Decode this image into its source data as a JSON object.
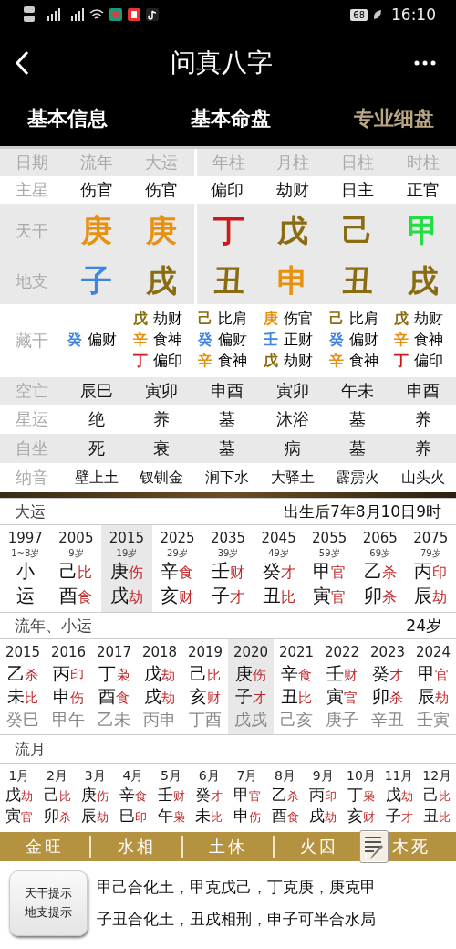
{
  "status_bar": {
    "battery": "68",
    "time": "16:10"
  },
  "header": {
    "title": "问真八字"
  },
  "tabs": [
    {
      "label": "基本信息",
      "selected": false
    },
    {
      "label": "基本命盘",
      "selected": false
    },
    {
      "label": "专业细盘",
      "selected": true
    }
  ],
  "pillars": {
    "columns": [
      "日期",
      "流年",
      "大运",
      "年柱",
      "月柱",
      "日柱",
      "时柱"
    ],
    "main_star": {
      "label": "主星",
      "values": [
        "伤官",
        "伤官",
        "偏印",
        "劫财",
        "日主",
        "正官"
      ]
    },
    "stems": {
      "label": "天干",
      "values": [
        {
          "char": "庚",
          "color": "#e8900f"
        },
        {
          "char": "庚",
          "color": "#e8900f"
        },
        {
          "char": "丁",
          "color": "#cc1a1a"
        },
        {
          "char": "戊",
          "color": "#8a6d12"
        },
        {
          "char": "己",
          "color": "#8a6d12"
        },
        {
          "char": "甲",
          "color": "#22dd44"
        }
      ]
    },
    "branches": {
      "label": "地支",
      "values": [
        {
          "char": "子",
          "color": "#3d85e0"
        },
        {
          "char": "戌",
          "color": "#8a6d12"
        },
        {
          "char": "丑",
          "color": "#8a6d12"
        },
        {
          "char": "申",
          "color": "#e8900f"
        },
        {
          "char": "丑",
          "color": "#8a6d12"
        },
        {
          "char": "戌",
          "color": "#8a6d12"
        }
      ]
    },
    "hidden": {
      "label": "藏干",
      "cells": [
        [
          {
            "char": "癸",
            "color": "#3d85e0",
            "god": "偏财"
          }
        ],
        [
          {
            "char": "戊",
            "color": "#8a6d12",
            "god": "劫财"
          },
          {
            "char": "辛",
            "color": "#e8900f",
            "god": "食神"
          },
          {
            "char": "丁",
            "color": "#cc1a1a",
            "god": "偏印"
          }
        ],
        [
          {
            "char": "己",
            "color": "#8a6d12",
            "god": "比肩"
          },
          {
            "char": "癸",
            "color": "#3d85e0",
            "god": "偏财"
          },
          {
            "char": "辛",
            "color": "#e8900f",
            "god": "食神"
          }
        ],
        [
          {
            "char": "庚",
            "color": "#e8900f",
            "god": "伤官"
          },
          {
            "char": "壬",
            "color": "#3d85e0",
            "god": "正财"
          },
          {
            "char": "戊",
            "color": "#8a6d12",
            "god": "劫财"
          }
        ],
        [
          {
            "char": "己",
            "color": "#8a6d12",
            "god": "比肩"
          },
          {
            "char": "癸",
            "color": "#3d85e0",
            "god": "偏财"
          },
          {
            "char": "辛",
            "color": "#e8900f",
            "god": "食神"
          }
        ],
        [
          {
            "char": "戊",
            "color": "#8a6d12",
            "god": "劫财"
          },
          {
            "char": "辛",
            "color": "#e8900f",
            "god": "食神"
          },
          {
            "char": "丁",
            "color": "#cc1a1a",
            "god": "偏印"
          }
        ]
      ]
    },
    "info_rows": [
      {
        "label": "空亡",
        "values": [
          "辰巳",
          "寅卯",
          "申酉",
          "寅卯",
          "午未",
          "申酉"
        ]
      },
      {
        "label": "星运",
        "values": [
          "绝",
          "养",
          "墓",
          "沐浴",
          "墓",
          "养"
        ]
      },
      {
        "label": "自坐",
        "values": [
          "死",
          "衰",
          "墓",
          "病",
          "墓",
          "养"
        ]
      },
      {
        "label": "纳音",
        "values": [
          "壁上土",
          "钗钏金",
          "涧下水",
          "大驿土",
          "霹雳火",
          "山头火"
        ]
      }
    ]
  },
  "da_yun": {
    "title": "大运",
    "note": "出生后7年8月10日9时",
    "columns": [
      {
        "year": "1997",
        "age": "1~8岁",
        "stem": "小",
        "branch": "运",
        "selected": false
      },
      {
        "year": "2005",
        "age": "9岁",
        "stem": "己",
        "stem_god": "比",
        "branch": "酉",
        "branch_god": "食",
        "selected": false
      },
      {
        "year": "2015",
        "age": "19岁",
        "stem": "庚",
        "stem_god": "伤",
        "branch": "戌",
        "branch_god": "劫",
        "selected": true
      },
      {
        "year": "2025",
        "age": "29岁",
        "stem": "辛",
        "stem_god": "食",
        "branch": "亥",
        "branch_god": "财",
        "selected": false
      },
      {
        "year": "2035",
        "age": "39岁",
        "stem": "壬",
        "stem_god": "财",
        "branch": "子",
        "branch_god": "才",
        "selected": false
      },
      {
        "year": "2045",
        "age": "49岁",
        "stem": "癸",
        "stem_god": "才",
        "branch": "丑",
        "branch_god": "比",
        "selected": false
      },
      {
        "year": "2055",
        "age": "59岁",
        "stem": "甲",
        "stem_god": "官",
        "branch": "寅",
        "branch_god": "官",
        "selected": false
      },
      {
        "year": "2065",
        "age": "69岁",
        "stem": "乙",
        "stem_god": "杀",
        "branch": "卯",
        "branch_god": "杀",
        "selected": false
      },
      {
        "year": "2075",
        "age": "79岁",
        "stem": "丙",
        "stem_god": "印",
        "branch": "辰",
        "branch_god": "劫",
        "selected": false
      }
    ]
  },
  "liu_nian": {
    "title": "流年、小运",
    "age": "24岁",
    "columns": [
      {
        "year": "2015",
        "stem": "乙",
        "stem_god": "杀",
        "branch": "未",
        "branch_god": "比",
        "xiao_yun": "癸巳",
        "selected": false
      },
      {
        "year": "2016",
        "stem": "丙",
        "stem_god": "印",
        "branch": "申",
        "branch_god": "伤",
        "xiao_yun": "甲午",
        "selected": false
      },
      {
        "year": "2017",
        "stem": "丁",
        "stem_god": "枭",
        "branch": "酉",
        "branch_god": "食",
        "xiao_yun": "乙未",
        "selected": false
      },
      {
        "year": "2018",
        "stem": "戊",
        "stem_god": "劫",
        "branch": "戌",
        "branch_god": "劫",
        "xiao_yun": "丙申",
        "selected": false
      },
      {
        "year": "2019",
        "stem": "己",
        "stem_god": "比",
        "branch": "亥",
        "branch_god": "财",
        "xiao_yun": "丁酉",
        "selected": false
      },
      {
        "year": "2020",
        "stem": "庚",
        "stem_god": "伤",
        "branch": "子",
        "branch_god": "才",
        "xiao_yun": "戊戌",
        "selected": true
      },
      {
        "year": "2021",
        "stem": "辛",
        "stem_god": "食",
        "branch": "丑",
        "branch_god": "比",
        "xiao_yun": "己亥",
        "selected": false
      },
      {
        "year": "2022",
        "stem": "壬",
        "stem_god": "财",
        "branch": "寅",
        "branch_god": "官",
        "xiao_yun": "庚子",
        "selected": false
      },
      {
        "year": "2023",
        "stem": "癸",
        "stem_god": "才",
        "branch": "卯",
        "branch_god": "杀",
        "xiao_yun": "辛丑",
        "selected": false
      },
      {
        "year": "2024",
        "stem": "甲",
        "stem_god": "官",
        "branch": "辰",
        "branch_god": "劫",
        "xiao_yun": "壬寅",
        "selected": false
      }
    ]
  },
  "liu_yue": {
    "title": "流月",
    "columns": [
      {
        "month": "1月",
        "stem": "戊",
        "stem_god": "劫",
        "branch": "寅",
        "branch_god": "官"
      },
      {
        "month": "2月",
        "stem": "己",
        "stem_god": "比",
        "branch": "卯",
        "branch_god": "杀"
      },
      {
        "month": "3月",
        "stem": "庚",
        "stem_god": "伤",
        "branch": "辰",
        "branch_god": "劫"
      },
      {
        "month": "4月",
        "stem": "辛",
        "stem_god": "食",
        "branch": "巳",
        "branch_god": "印"
      },
      {
        "month": "5月",
        "stem": "壬",
        "stem_god": "财",
        "branch": "午",
        "branch_god": "枭"
      },
      {
        "month": "6月",
        "stem": "癸",
        "stem_god": "才",
        "branch": "未",
        "branch_god": "比"
      },
      {
        "month": "7月",
        "stem": "甲",
        "stem_god": "官",
        "branch": "申",
        "branch_god": "伤"
      },
      {
        "month": "8月",
        "stem": "乙",
        "stem_god": "杀",
        "branch": "酉",
        "branch_god": "食"
      },
      {
        "month": "9月",
        "stem": "丙",
        "stem_god": "印",
        "branch": "戌",
        "branch_god": "劫"
      },
      {
        "month": "10月",
        "stem": "丁",
        "stem_god": "枭",
        "branch": "亥",
        "branch_god": "财"
      },
      {
        "month": "11月",
        "stem": "戊",
        "stem_god": "劫",
        "branch": "子",
        "branch_god": "才"
      },
      {
        "month": "12月",
        "stem": "己",
        "stem_god": "比",
        "branch": "丑",
        "branch_god": "比"
      }
    ]
  },
  "seasons": [
    "金旺",
    "水相",
    "土休",
    "火囚",
    "木死"
  ],
  "hints": {
    "button": [
      "天干提示",
      "地支提示"
    ],
    "lines": [
      "甲己合化土，甲克戊己，丁克庚，庚克甲",
      "子丑合化土，丑戌相刑，申子可半合水局"
    ]
  }
}
